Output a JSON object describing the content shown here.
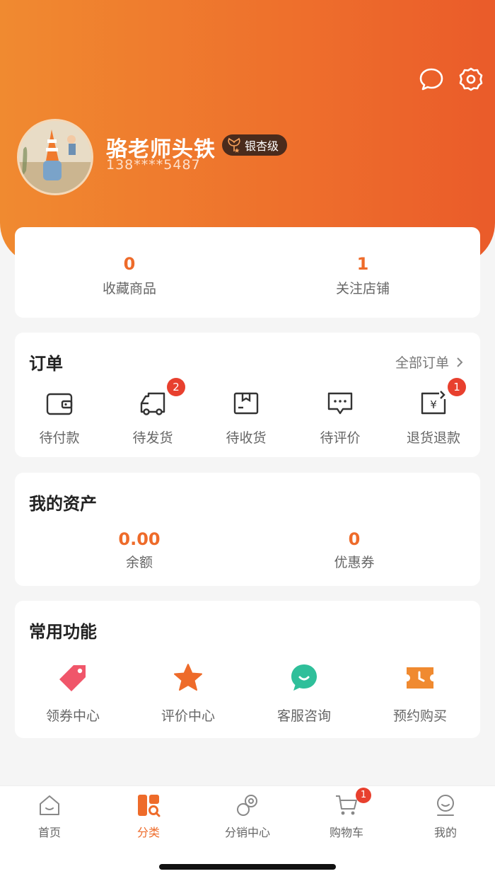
{
  "profile": {
    "username": "骆老师头铁",
    "level": "银杏级",
    "phone": "138****5487"
  },
  "stats": [
    {
      "value": "0",
      "label": "收藏商品"
    },
    {
      "value": "1",
      "label": "关注店铺"
    }
  ],
  "orders": {
    "title": "订单",
    "all_label": "全部订单",
    "items": [
      {
        "label": "待付款",
        "icon": "wallet-icon",
        "badge": ""
      },
      {
        "label": "待发货",
        "icon": "truck-icon",
        "badge": "2"
      },
      {
        "label": "待收货",
        "icon": "package-icon",
        "badge": ""
      },
      {
        "label": "待评价",
        "icon": "comment-icon",
        "badge": ""
      },
      {
        "label": "退货退款",
        "icon": "refund-icon",
        "badge": "1"
      }
    ]
  },
  "assets": {
    "title": "我的资产",
    "items": [
      {
        "value": "0.00",
        "label": "余额"
      },
      {
        "value": "0",
        "label": "优惠券"
      }
    ]
  },
  "functions": {
    "title": "常用功能",
    "items": [
      {
        "label": "领券中心",
        "icon": "coupon-tag-icon"
      },
      {
        "label": "评价中心",
        "icon": "star-icon"
      },
      {
        "label": "客服咨询",
        "icon": "chat-bubble-icon"
      },
      {
        "label": "预约购买",
        "icon": "ticket-clock-icon"
      }
    ]
  },
  "tabbar": [
    {
      "label": "首页",
      "icon": "home-icon",
      "active": false
    },
    {
      "label": "分类",
      "icon": "category-icon",
      "active": true
    },
    {
      "label": "分销中心",
      "icon": "distribution-icon",
      "active": false
    },
    {
      "label": "购物车",
      "icon": "cart-icon",
      "active": false,
      "badge": "1"
    },
    {
      "label": "我的",
      "icon": "profile-icon",
      "active": false
    }
  ],
  "colors": {
    "accent": "#ee6b2a",
    "badge": "#e8402e",
    "header_start": "#f08a30",
    "header_end": "#ea5b2a"
  }
}
